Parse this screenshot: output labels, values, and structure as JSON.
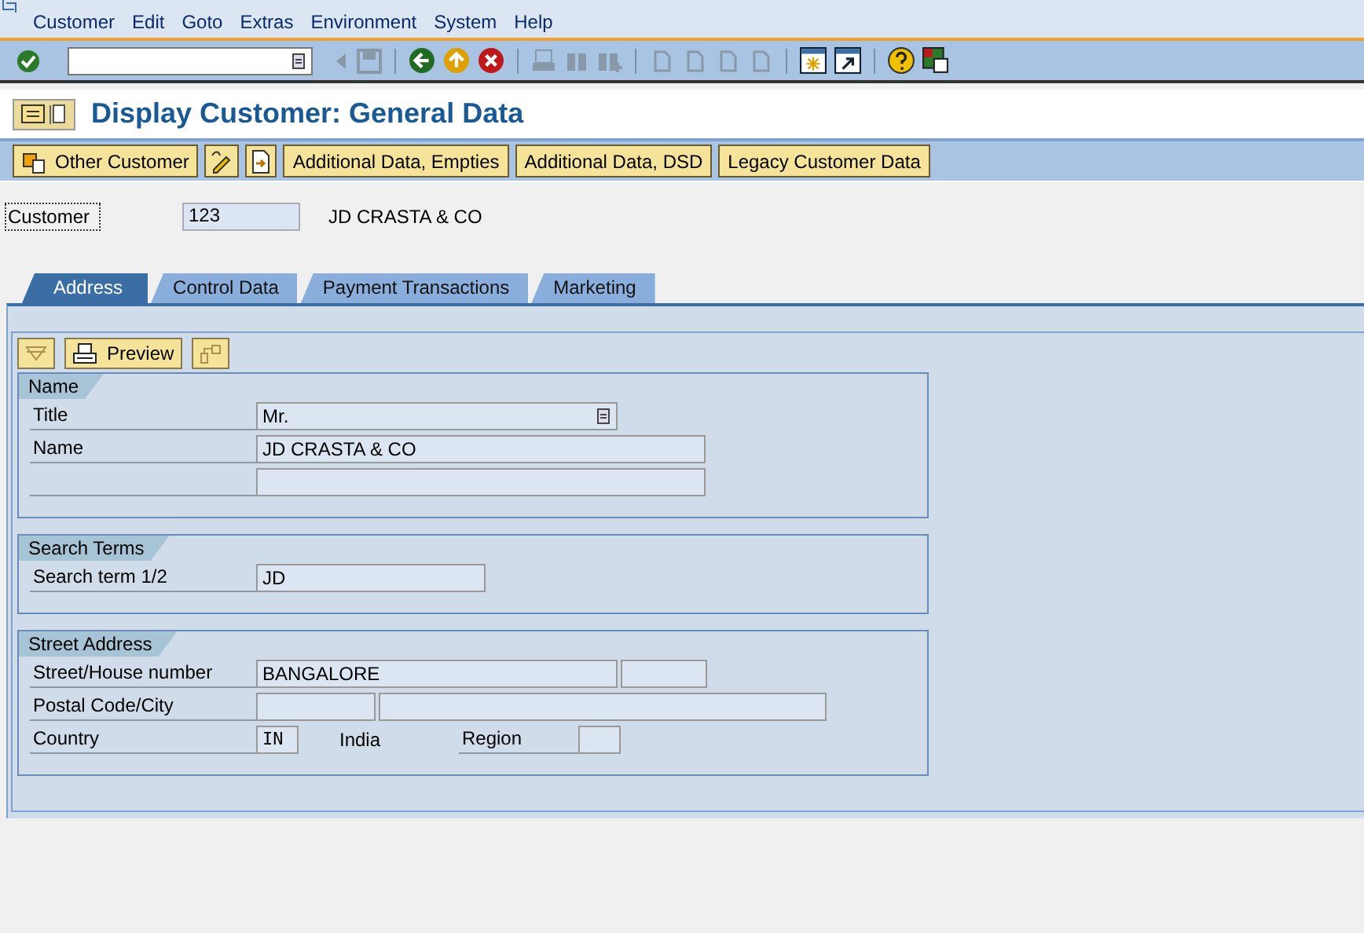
{
  "menu": [
    "Customer",
    "Edit",
    "Goto",
    "Extras",
    "Environment",
    "System",
    "Help"
  ],
  "title": "Display Customer: General Data",
  "app_toolbar": [
    {
      "kind": "icon-text",
      "label": "Other Customer"
    },
    {
      "kind": "edit-icon"
    },
    {
      "kind": "doc-icon"
    },
    {
      "kind": "text",
      "label": "Additional Data, Empties"
    },
    {
      "kind": "text",
      "label": "Additional Data, DSD"
    },
    {
      "kind": "text",
      "label": "Legacy Customer Data"
    }
  ],
  "customer": {
    "label": "Customer",
    "number": "123",
    "name": "JD CRASTA & CO"
  },
  "tabs": [
    {
      "label": "Address",
      "selected": true
    },
    {
      "label": "Control Data",
      "selected": false
    },
    {
      "label": "Payment Transactions",
      "selected": false
    },
    {
      "label": "Marketing",
      "selected": false
    }
  ],
  "preview_button": "Preview",
  "groups": [
    {
      "title": "Name",
      "rows": [
        {
          "label": "Title",
          "items": [
            {
              "kind": "dropdown",
              "value": "Mr."
            }
          ]
        },
        {
          "label": "Name",
          "items": [
            {
              "kind": "field",
              "value": "JD CRASTA & CO"
            }
          ]
        },
        {
          "items": [
            {
              "kind": "field"
            }
          ]
        }
      ]
    },
    {
      "title": "Search Terms",
      "rows": [
        {
          "label": "Search term 1/2",
          "items": [
            {
              "kind": "field",
              "value": "JD"
            }
          ]
        }
      ]
    },
    {
      "title": "Street Address",
      "rows": [
        {
          "label": "Street/House number",
          "items": [
            {
              "kind": "field",
              "value": "BANGALORE"
            },
            {
              "kind": "field"
            }
          ]
        },
        {
          "label": "Postal Code/City",
          "items": [
            {
              "kind": "field"
            },
            {
              "kind": "field"
            }
          ]
        },
        {
          "label": "Country",
          "items": [
            {
              "kind": "code",
              "value": "IN"
            },
            {
              "kind": "text",
              "value": "India"
            },
            {
              "kind": "label",
              "value": "Region"
            },
            {
              "kind": "field"
            }
          ]
        }
      ]
    }
  ]
}
